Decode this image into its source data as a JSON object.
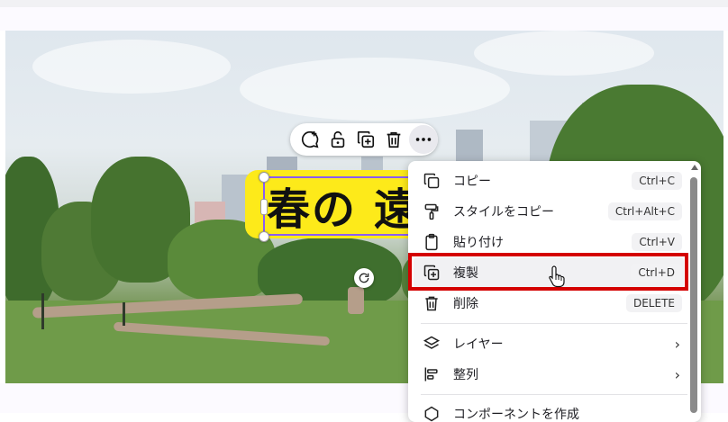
{
  "toolbar": {
    "buttons": [
      {
        "name": "comment-add",
        "icon": "comment-plus-icon"
      },
      {
        "name": "lock",
        "icon": "unlock-icon"
      },
      {
        "name": "duplicate",
        "icon": "duplicate-icon"
      },
      {
        "name": "delete",
        "icon": "trash-icon"
      },
      {
        "name": "more",
        "icon": "more-horizontal-icon"
      }
    ]
  },
  "canvas": {
    "text_element": "春の 遠"
  },
  "context_menu": {
    "items": [
      {
        "label": "コピー",
        "shortcut": "Ctrl+C",
        "icon": "copy-icon"
      },
      {
        "label": "スタイルをコピー",
        "shortcut": "Ctrl+Alt+C",
        "icon": "paint-roller-icon"
      },
      {
        "label": "貼り付け",
        "shortcut": "Ctrl+V",
        "icon": "clipboard-icon"
      },
      {
        "label": "複製",
        "shortcut": "Ctrl+D",
        "icon": "duplicate-icon"
      },
      {
        "label": "削除",
        "shortcut": "DELETE",
        "icon": "trash-icon"
      },
      {
        "label": "レイヤー",
        "icon": "layers-icon"
      },
      {
        "label": "整列",
        "icon": "align-icon"
      },
      {
        "label": "コンポーネントを作成",
        "icon": "component-icon"
      }
    ],
    "highlighted_item": "複製"
  },
  "colors": {
    "text_bg": "#fdea1a",
    "selection": "#8a5cf6",
    "highlight_box": "#d40000"
  }
}
